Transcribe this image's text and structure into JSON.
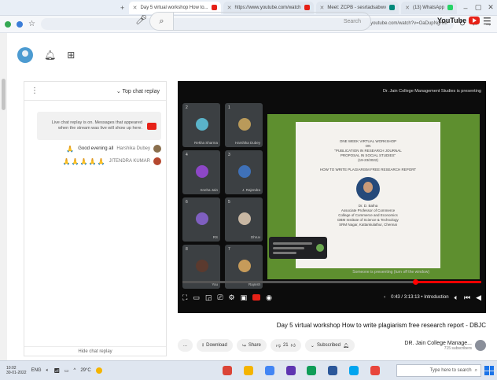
{
  "browser": {
    "tabs": [
      {
        "label": "(13) WhatsApp",
        "active": false,
        "favicon": "whatsapp-icon"
      },
      {
        "label": "Meet: ZCPB - sesrtadsabwv",
        "active": false,
        "favicon": "meet-icon"
      },
      {
        "label": "https://www.youtube.com/watch",
        "active": false,
        "favicon": "youtube-icon"
      },
      {
        "label": "Day 5 virtual workshop How to...",
        "active": true,
        "favicon": "youtube-icon"
      }
    ],
    "url": "youtube.com/watch?v=OaDupNgHm",
    "window_controls": [
      "minimize-icon",
      "maximize-icon",
      "close-icon"
    ]
  },
  "youtube": {
    "logo_text": "YouTube",
    "search_placeholder": "Search"
  },
  "chat": {
    "header": "Top chat replay",
    "notice": "Live chat replay is on. Messages that appeared when the stream was live will show up here.",
    "messages": [
      {
        "author": "Harshika Dubey",
        "text": "Good evening all",
        "emoji": "🙏"
      },
      {
        "author": "JITENDRA KUMAR",
        "text": "",
        "emoji": "🙏🙏🙏🙏🙏"
      }
    ],
    "footer": "Hide chat replay"
  },
  "player": {
    "title_bar": "Dr. Jain College Management Studies is presenting",
    "tiles": [
      {
        "num": "1",
        "name": "Harshika Dubey",
        "color": "#b99a5a"
      },
      {
        "num": "2",
        "name": "Rekha Sharma",
        "color": "#5ab3c9"
      },
      {
        "num": "3",
        "name": "J. Rajendra",
        "color": "#3f71b8"
      },
      {
        "num": "4",
        "name": "Sneha Jain",
        "color": "#8d47c7"
      },
      {
        "num": "5",
        "name": "Dhruv",
        "color": "#c8b7a3"
      },
      {
        "num": "6",
        "name": "RS",
        "color": "#7f5fc0"
      },
      {
        "num": "7",
        "name": "Rajnish",
        "color": "#c69b5a"
      },
      {
        "num": "8",
        "name": "You",
        "color": "#5b3a2e"
      }
    ],
    "slide_lines": [
      "ONE WEEK VIRTUAL WORKSHOP",
      "ON",
      "\"PUBLICATION IN RESEARCH JOURNAL",
      "PROPOSAL IN SOCIAL STUDIES\"",
      "(19-23/2022)",
      "HOW TO WRITE PLAGIARISM FREE RESEARCH REPORT"
    ],
    "speaker_lines": [
      "Dr. D. Bafna",
      "Associate Professor of Commerce",
      "College of Commerce and Economics",
      "DBM Institute of Science & Technology",
      "SRM Nagar, Kattankulathur, Chennai"
    ],
    "caption": "Someone is presenting (turn off the window)",
    "time": "0:43 / 3:13:13 • Introduction",
    "progress": 0.22
  },
  "video": {
    "title": "Day 5 virtual workshop How to write plagiarism free research report - DBJC",
    "channel_name": "DR. Jain College Manage...",
    "channel_subs": "715 subscribers",
    "subscribed_label": "Subscribed",
    "like_count": "21",
    "share_label": "Share",
    "download_label": "Download",
    "more_label": "..."
  },
  "taskbar": {
    "search_placeholder": "Type here to search",
    "weather": "29°C",
    "time": "10:02",
    "date": "30-01-2022",
    "language": "ENG",
    "apps": [
      {
        "name": "chrome-icon",
        "color": "#db4437"
      },
      {
        "name": "file-explorer-icon",
        "color": "#f4b400"
      },
      {
        "name": "mail-icon",
        "color": "#4285f4"
      },
      {
        "name": "store-icon",
        "color": "#5e35b1"
      },
      {
        "name": "edge-icon",
        "color": "#0f9d58"
      },
      {
        "name": "word-icon",
        "color": "#2b579a"
      },
      {
        "name": "photos-icon",
        "color": "#00a4ef"
      },
      {
        "name": "chrome-icon-2",
        "color": "#e8453c"
      }
    ]
  }
}
